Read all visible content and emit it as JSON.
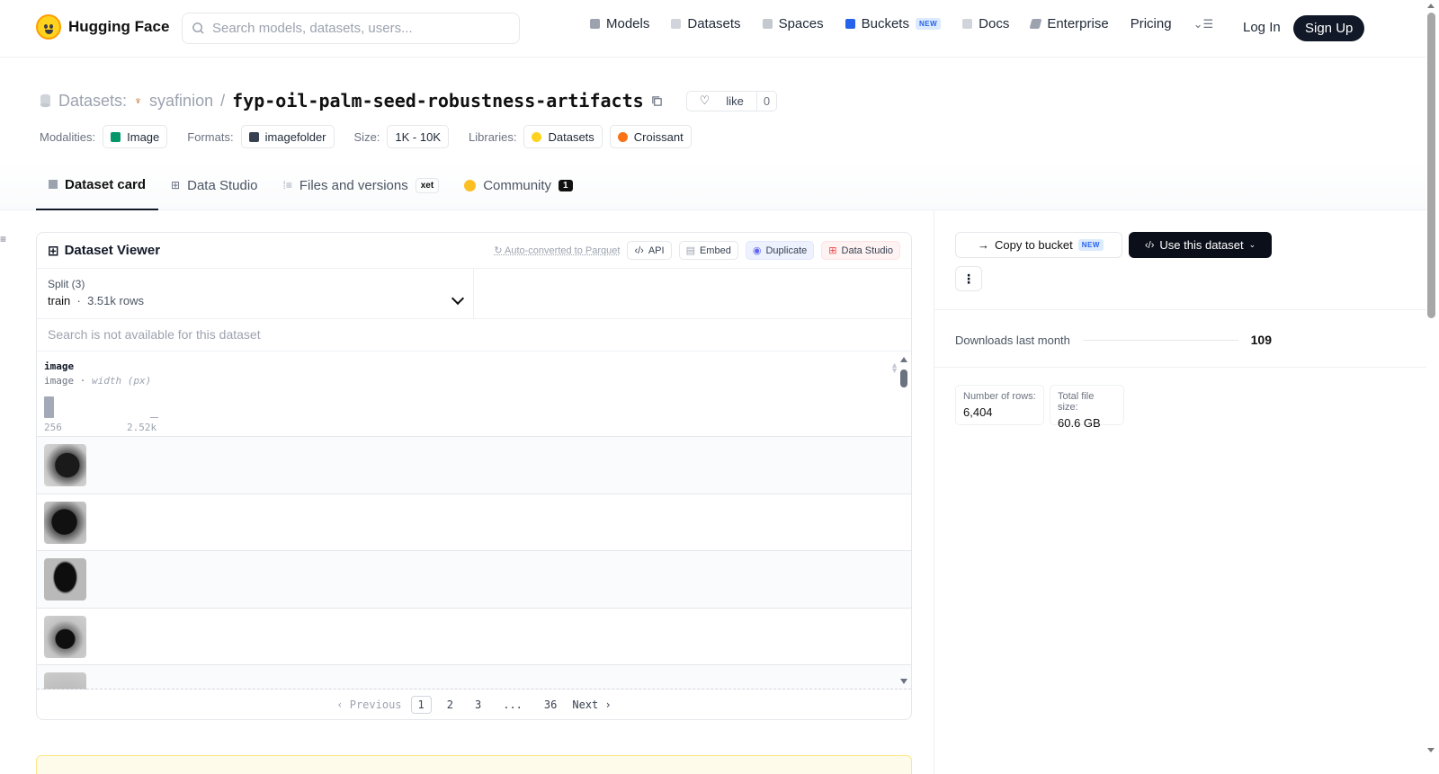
{
  "header": {
    "logo_text": "Hugging Face",
    "search_placeholder": "Search models, datasets, users...",
    "nav": [
      {
        "label": "Models",
        "icon": "cube-icon",
        "color": "#9ca3af"
      },
      {
        "label": "Datasets",
        "icon": "database-icon",
        "color": "#9ca3af"
      },
      {
        "label": "Spaces",
        "icon": "grid-icon",
        "color": "#9ca3af"
      },
      {
        "label": "Buckets",
        "icon": "bucket-icon",
        "color": "#2563eb",
        "badge": "NEW"
      },
      {
        "label": "Docs",
        "icon": "book-icon",
        "color": "#9ca3af"
      },
      {
        "label": "Enterprise",
        "icon": "enterprise-icon",
        "color": "#6b7280"
      },
      {
        "label": "Pricing"
      }
    ],
    "login": "Log In",
    "signup": "Sign Up"
  },
  "repo": {
    "type_label": "Datasets:",
    "owner": "syafinion",
    "separator": "/",
    "name": "fyp-oil-palm-seed-robustness-artifacts",
    "like_label": "like",
    "like_count": "0"
  },
  "meta": {
    "modalities_label": "Modalities:",
    "modality": "Image",
    "formats_label": "Formats:",
    "format": "imagefolder",
    "size_label": "Size:",
    "size": "1K - 10K",
    "libraries_label": "Libraries:",
    "libraries": [
      "Datasets",
      "Croissant"
    ]
  },
  "tabs": [
    {
      "label": "Dataset card",
      "active": true
    },
    {
      "label": "Data Studio"
    },
    {
      "label": "Files and versions",
      "badge": "xet"
    },
    {
      "label": "Community",
      "count": "1"
    }
  ],
  "viewer": {
    "title": "Dataset Viewer",
    "auto_converted": "Auto-converted to Parquet",
    "actions": [
      "API",
      "Embed",
      "Duplicate",
      "Data Studio"
    ],
    "split_label": "Split (3)",
    "split_value": "train",
    "split_rows": "3.51k rows",
    "search_na": "Search is not available for this dataset",
    "column": {
      "name": "image",
      "type": "image",
      "stat": "width (px)",
      "min": "256",
      "max": "2.52k"
    },
    "row_count_visible": 5,
    "pager": {
      "prev": "Previous",
      "pages": [
        "1",
        "2",
        "3",
        "...",
        "36"
      ],
      "current": "1",
      "next": "Next"
    }
  },
  "sidebar": {
    "copy_bucket": "Copy to bucket",
    "copy_badge": "NEW",
    "use_dataset": "Use this dataset",
    "downloads_label": "Downloads last month",
    "downloads": "109",
    "rows_label": "Number of rows:",
    "rows": "6,404",
    "filesize_label": "Total file size:",
    "filesize": "60.6 GB"
  }
}
